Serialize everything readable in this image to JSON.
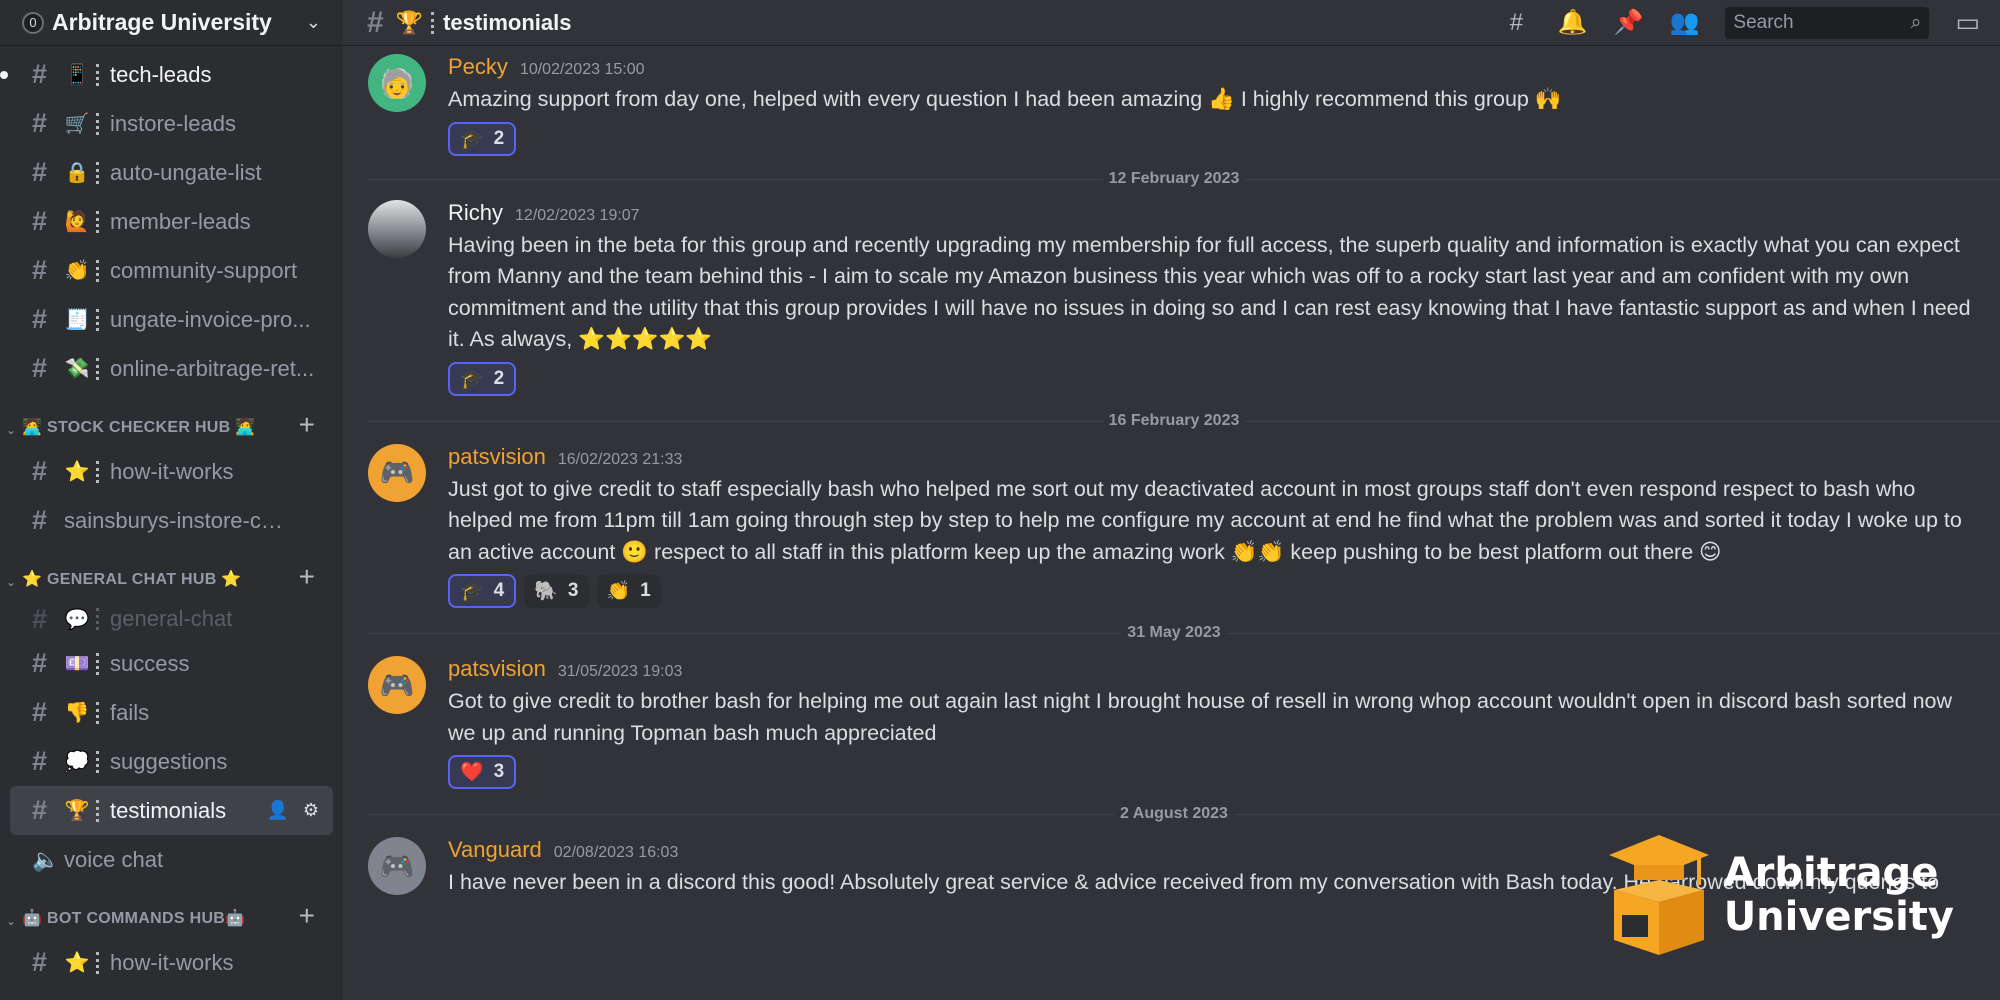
{
  "server": {
    "name": "Arbitrage University",
    "icon": "0"
  },
  "channels_top": [
    {
      "emoji": "📱",
      "label": "tech-leads",
      "unread": true
    },
    {
      "emoji": "🛒",
      "label": "instore-leads"
    },
    {
      "emoji": "🔒",
      "label": "auto-ungate-list"
    },
    {
      "emoji": "🙋",
      "label": "member-leads"
    },
    {
      "emoji": "👏",
      "label": "community-support"
    },
    {
      "emoji": "🧾",
      "label": "ungate-invoice-pro..."
    },
    {
      "emoji": "💸",
      "label": "online-arbitrage-ret..."
    }
  ],
  "category_stock": {
    "label": "🧑‍💻 STOCK CHECKER HUB 🧑‍💻"
  },
  "channels_stock": [
    {
      "emoji": "⭐",
      "label": "how-it-works",
      "sep": true
    },
    {
      "label": "sainsburys-instore-check"
    }
  ],
  "category_general": {
    "label": "⭐ GENERAL CHAT HUB ⭐"
  },
  "channels_general": [
    {
      "emoji": "💬",
      "label": "general-chat",
      "muted": true
    },
    {
      "emoji": "💷",
      "label": "success"
    },
    {
      "emoji": "👎",
      "label": "fails"
    },
    {
      "emoji": "💭",
      "label": "suggestions"
    },
    {
      "emoji": "🏆",
      "label": "testimonials",
      "active": true
    },
    {
      "label": "voice chat",
      "voice": true
    }
  ],
  "category_bot": {
    "label": "🤖 BOT COMMANDS HUB🤖"
  },
  "channels_bot": [
    {
      "emoji": "⭐",
      "label": "how-it-works"
    }
  ],
  "topbar": {
    "emoji": "🏆",
    "title": "testimonials",
    "search_placeholder": "Search"
  },
  "messages": [
    {
      "author": "Pecky",
      "timestamp": "10/02/2023 15:00",
      "text": "Amazing support from day one, helped with every question I had been amazing 👍 I highly recommend this group 🙌",
      "reactions": [
        {
          "emoji": "🎓",
          "count": "2",
          "mine": true
        }
      ]
    },
    {
      "divider": "12 February 2023"
    },
    {
      "author": "Richy",
      "timestamp": "12/02/2023 19:07",
      "text": "Having been in the beta for this group and recently upgrading my membership for full access, the superb quality and information is exactly what you can expect from Manny and the team behind this - I aim to scale my Amazon business this year which was off to a rocky start last year and am confident with my own commitment and the utility that this group provides I will have no issues in doing so and I can rest easy knowing that I have fantastic support as and when I need it. As always, ⭐⭐⭐⭐⭐",
      "reactions": [
        {
          "emoji": "🎓",
          "count": "2",
          "mine": true
        }
      ]
    },
    {
      "divider": "16 February 2023"
    },
    {
      "author": "patsvision",
      "timestamp": "16/02/2023 21:33",
      "text": "Just got to give credit to staff especially bash who helped me sort out my deactivated account in most groups staff don't even respond respect to bash who helped me from 11pm till 1am going through step by step to help me configure my account at end he find what the problem was and sorted it today I woke up to an active account 🙂 respect to all staff in this platform keep up the amazing work 👏👏 keep pushing to be best platform out there 😊",
      "reactions": [
        {
          "emoji": "🎓",
          "count": "4",
          "mine": true
        },
        {
          "emoji": "🐘",
          "count": "3"
        },
        {
          "emoji": "👏",
          "count": "1"
        }
      ]
    },
    {
      "divider": "31 May 2023"
    },
    {
      "author": "patsvision",
      "timestamp": "31/05/2023 19:03",
      "text": "Got to give credit to brother bash for helping me out again last night I brought house of resell in wrong whop account wouldn't open in discord bash sorted now we up and running Topman bash much appreciated",
      "reactions": [
        {
          "emoji": "❤️",
          "count": "3",
          "mine": true
        }
      ]
    },
    {
      "divider": "2 August 2023"
    },
    {
      "author": "Vanguard",
      "timestamp": "02/08/2023 16:03",
      "text": "I have never been in a discord this good! Absolutely great service & advice received from my conversation with Bash today. He narrowed down my queries to",
      "reactions": []
    }
  ],
  "logo": {
    "line1": "Arbitrage",
    "line2": "University"
  }
}
